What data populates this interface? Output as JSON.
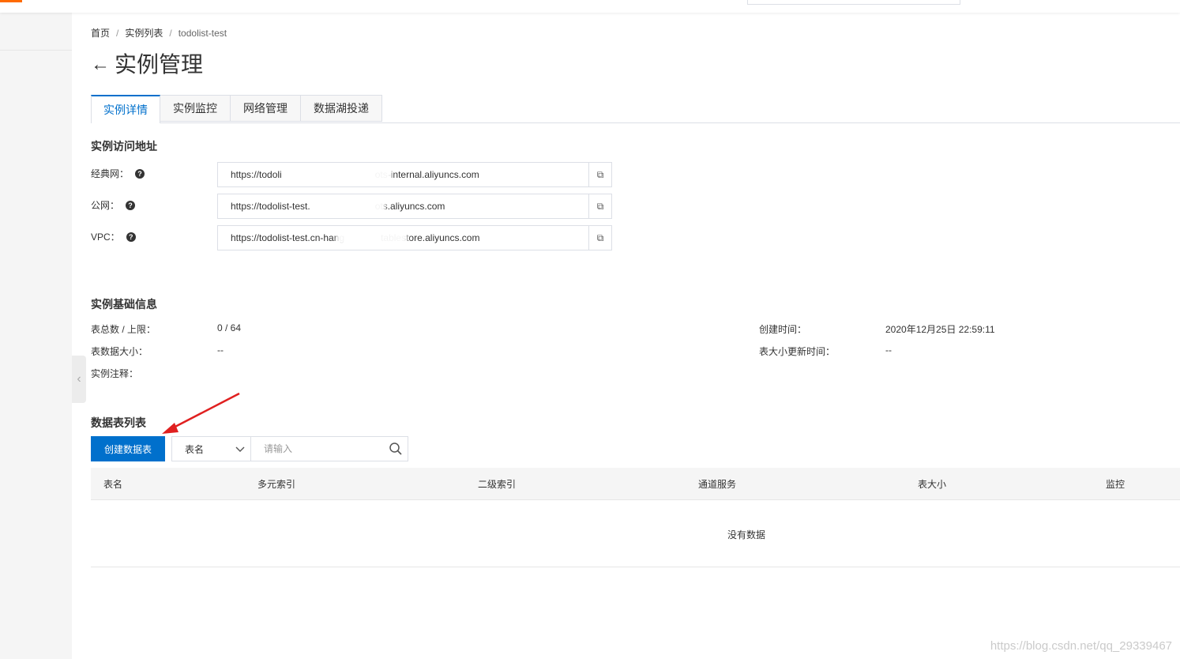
{
  "breadcrumb": {
    "home": "首页",
    "instances": "实例列表",
    "current": "todolist-test",
    "separator": "/"
  },
  "page": {
    "back_icon": "←",
    "title": "实例管理"
  },
  "tabs": [
    {
      "label": "实例详情",
      "active": true
    },
    {
      "label": "实例监控",
      "active": false
    },
    {
      "label": "网络管理",
      "active": false
    },
    {
      "label": "数据湖投递",
      "active": false
    }
  ],
  "access": {
    "title": "实例访问地址",
    "rows": [
      {
        "label": "经典网：",
        "value": "https://todoli",
        "value_tail": "ots-internal.aliyuncs.com"
      },
      {
        "label": "公网：",
        "value": "https://todolist-test.",
        "value_tail": "ots.aliyuncs.com"
      },
      {
        "label": "VPC：",
        "value": "https://todolist-test.cn-hang",
        "value_tail": "tablestore.aliyuncs.com"
      }
    ],
    "help_icon": "?",
    "copy_icon": "⧉"
  },
  "basic": {
    "title": "实例基础信息",
    "left": [
      {
        "label": "表总数 / 上限：",
        "value": "0 / 64"
      },
      {
        "label": "表数据大小：",
        "value": "--"
      },
      {
        "label": "实例注释：",
        "value": ""
      }
    ],
    "right": [
      {
        "label": "创建时间：",
        "value": "2020年12月25日 22:59:11"
      },
      {
        "label": "表大小更新时间：",
        "value": "--"
      }
    ]
  },
  "tables": {
    "title": "数据表列表",
    "create_button": "创建数据表",
    "select_value": "表名",
    "search_placeholder": "请输入",
    "columns": [
      "表名",
      "多元索引",
      "二级索引",
      "通道服务",
      "表大小",
      "监控"
    ],
    "empty_text": "没有数据"
  },
  "watermark": "https://blog.csdn.net/qq_29339467",
  "colors": {
    "primary": "#0070cc",
    "annotation_arrow": "#e02020"
  }
}
